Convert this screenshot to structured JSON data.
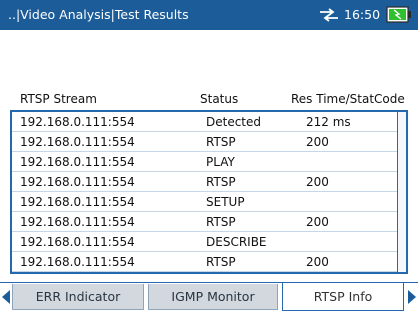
{
  "header": {
    "title": "..|Video Analysis|Test Results",
    "time": "16:50",
    "icons": [
      "usb-connection-icon",
      "battery-icon"
    ],
    "background_color": "#1c5d99"
  },
  "table": {
    "columns": [
      "RTSP Stream",
      "Status",
      "Res Time/StatCode"
    ],
    "rows": [
      {
        "stream": "192.168.0.111:554",
        "status": "Detected",
        "code": "212 ms"
      },
      {
        "stream": "192.168.0.111:554",
        "status": "RTSP",
        "code": "200"
      },
      {
        "stream": "192.168.0.111:554",
        "status": "PLAY",
        "code": ""
      },
      {
        "stream": "192.168.0.111:554",
        "status": "RTSP",
        "code": "200"
      },
      {
        "stream": "192.168.0.111:554",
        "status": "SETUP",
        "code": ""
      },
      {
        "stream": "192.168.0.111:554",
        "status": "RTSP",
        "code": "200"
      },
      {
        "stream": "192.168.0.111:554",
        "status": "DESCRIBE",
        "code": ""
      },
      {
        "stream": "192.168.0.111:554",
        "status": "RTSP",
        "code": "200"
      }
    ]
  },
  "tabs": [
    {
      "label": "ERR Indicator",
      "active": false
    },
    {
      "label": "IGMP Monitor",
      "active": false
    },
    {
      "label": "RTSP Info",
      "active": true
    }
  ]
}
